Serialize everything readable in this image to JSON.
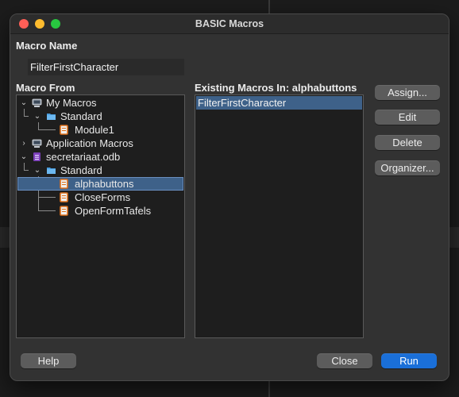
{
  "window": {
    "title": "BASIC Macros"
  },
  "macro_name": {
    "label": "Macro Name",
    "value": "FilterFirstCharacter"
  },
  "macro_from": {
    "label": "Macro From",
    "tree": [
      {
        "label": "My Macros",
        "icon": "computer-icon",
        "expanded": true
      },
      {
        "label": "Standard",
        "icon": "folder-icon",
        "expanded": true
      },
      {
        "label": "Module1",
        "icon": "module-icon"
      },
      {
        "label": "Application Macros",
        "icon": "computer-icon",
        "expanded": false
      },
      {
        "label": "secretariaat.odb",
        "icon": "database-icon",
        "expanded": true
      },
      {
        "label": "Standard",
        "icon": "folder-icon",
        "expanded": true
      },
      {
        "label": "alphabuttons",
        "icon": "module-icon",
        "selected": true
      },
      {
        "label": "CloseForms",
        "icon": "module-icon"
      },
      {
        "label": "OpenFormTafels",
        "icon": "module-icon"
      }
    ]
  },
  "existing_macros": {
    "label": "Existing Macros In: alphabuttons",
    "items": [
      "FilterFirstCharacter"
    ]
  },
  "buttons": {
    "assign": "Assign...",
    "edit": "Edit",
    "delete": "Delete",
    "organizer": "Organizer...",
    "help": "Help",
    "close": "Close",
    "run": "Run"
  },
  "colors": {
    "selection": "#3e6189",
    "primary_button": "#1a6fd8",
    "window_bg": "#323232"
  }
}
